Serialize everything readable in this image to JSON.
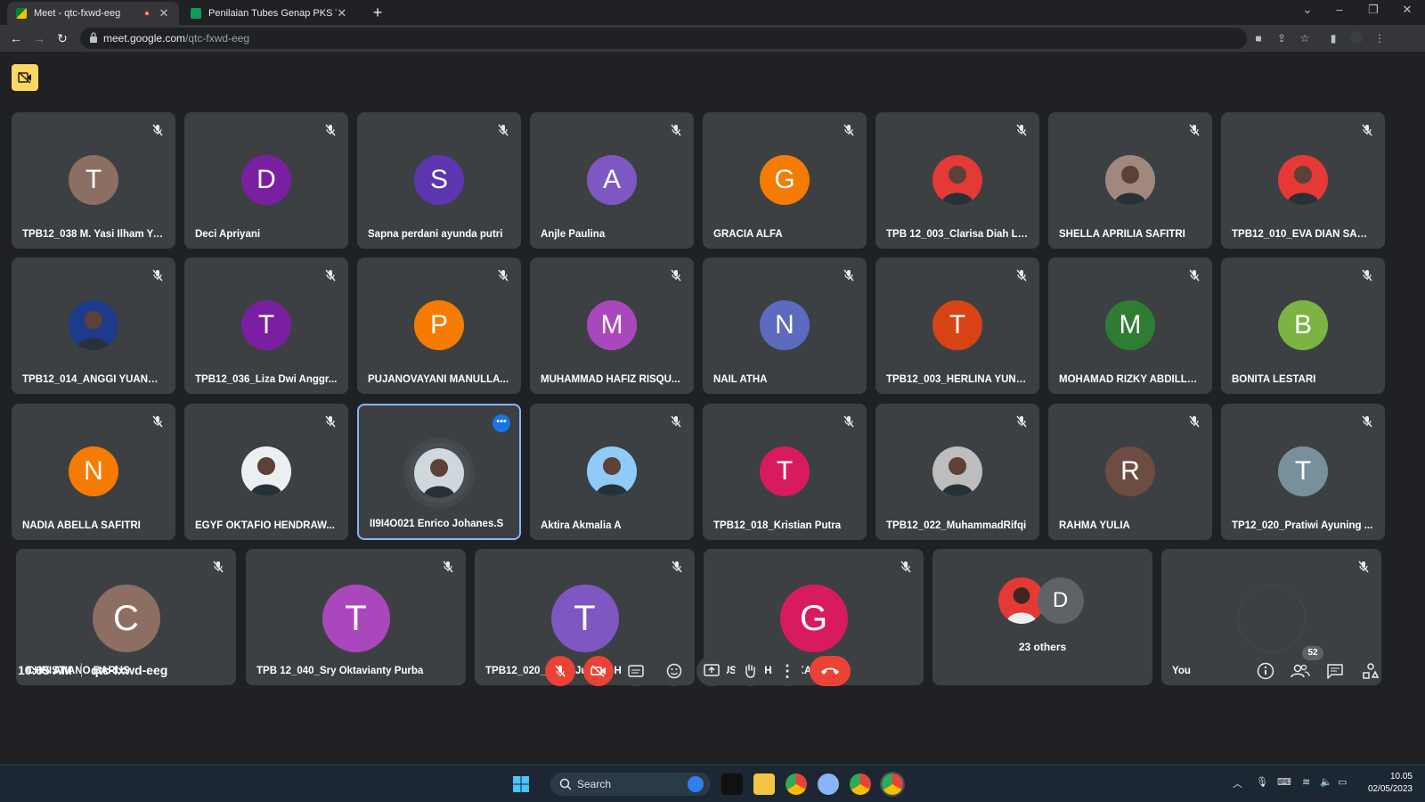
{
  "browser": {
    "tabs": [
      {
        "title": "Meet - qtc-fxwd-eeg",
        "active": true,
        "recording": true
      },
      {
        "title": "Penilaian Tubes Genap PKS TPB",
        "active": false
      }
    ],
    "address": {
      "domain": "meet.google.com",
      "path": "/qtc-fxwd-eeg"
    }
  },
  "meeting": {
    "time": "10:05 AM",
    "code": "qtc-fxwd-eeg",
    "participant_count": "52"
  },
  "tiles": [
    {
      "name": "TPB12_038 M. Yasi Ilham Yu...",
      "initial": "T",
      "color": "#8d6e63"
    },
    {
      "name": "Deci Apriyani",
      "initial": "D",
      "color": "#7b1fa2"
    },
    {
      "name": "Sapna perdani ayunda putri",
      "initial": "S",
      "color": "#5e35b1"
    },
    {
      "name": "Anjle Paulina",
      "initial": "A",
      "color": "#7e57c2"
    },
    {
      "name": "GRACIA ALFA",
      "initial": "G",
      "color": "#f57c00"
    },
    {
      "name": "TPB 12_003_Clarisa Diah Le...",
      "initial": "",
      "color": "#e53935"
    },
    {
      "name": "SHELLA APRILIA SAFITRI",
      "initial": "",
      "color": "#a1887f"
    },
    {
      "name": "TPB12_010_EVA DIAN SARI ...",
      "initial": "",
      "color": "#e53935"
    },
    {
      "name": "TPB12_014_ANGGI YUANA ...",
      "initial": "",
      "color": "#1e3a8a"
    },
    {
      "name": "TPB12_036_Liza Dwi Anggr...",
      "initial": "T",
      "color": "#7b1fa2"
    },
    {
      "name": "PUJANOVAYANI MANULLA...",
      "initial": "P",
      "color": "#f57c00"
    },
    {
      "name": "MUHAMMAD HAFIZ RISQU...",
      "initial": "M",
      "color": "#ab47bc"
    },
    {
      "name": "NAIL ATHA",
      "initial": "N",
      "color": "#5c6bc0"
    },
    {
      "name": "TPB12_003_HERLINA YUNIT...",
      "initial": "T",
      "color": "#d84315"
    },
    {
      "name": "MOHAMAD RIZKY ABDILLAH",
      "initial": "M",
      "color": "#2e7d32"
    },
    {
      "name": "BONITA LESTARI",
      "initial": "B",
      "color": "#7cb342"
    },
    {
      "name": "NADIA ABELLA SAFITRI",
      "initial": "N",
      "color": "#f57c00"
    },
    {
      "name": "EGYF OKTAFIO HENDRAW...",
      "initial": "",
      "color": "#eceff1"
    },
    {
      "name": "II9I4O021 Enrico Johanes.S",
      "initial": "",
      "color": "#cfd8dc"
    },
    {
      "name": "Aktira Akmalia A",
      "initial": "",
      "color": "#90caf9"
    },
    {
      "name": "TPB12_018_Kristian Putra",
      "initial": "T",
      "color": "#d81b60"
    },
    {
      "name": "TPB12_022_MuhammadRifqi",
      "initial": "",
      "color": "#bdbdbd"
    },
    {
      "name": "RAHMA YULIA",
      "initial": "R",
      "color": "#6d4c41"
    },
    {
      "name": "TP12_020_Pratiwi Ayuning ...",
      "initial": "T",
      "color": "#78909c"
    }
  ],
  "big_tiles": [
    {
      "name": "CHRISTIANO BARUS",
      "initial": "C",
      "color": "#8d6e63"
    },
    {
      "name": "TPB 12_040_Sry Oktavianty Purba",
      "initial": "T",
      "color": "#ab47bc"
    },
    {
      "name": "TPB12_020_Mitha Juanna Harlis",
      "initial": "T",
      "color": "#7e57c2"
    },
    {
      "name": "GUSTI MAHARDIKA",
      "initial": "G",
      "color": "#d81b60"
    }
  ],
  "others": {
    "label": "23 others",
    "initial": "D"
  },
  "self_tile": {
    "name": "You"
  },
  "taskbar": {
    "search_label": "Search",
    "time": "10.05",
    "date": "02/05/2023"
  }
}
